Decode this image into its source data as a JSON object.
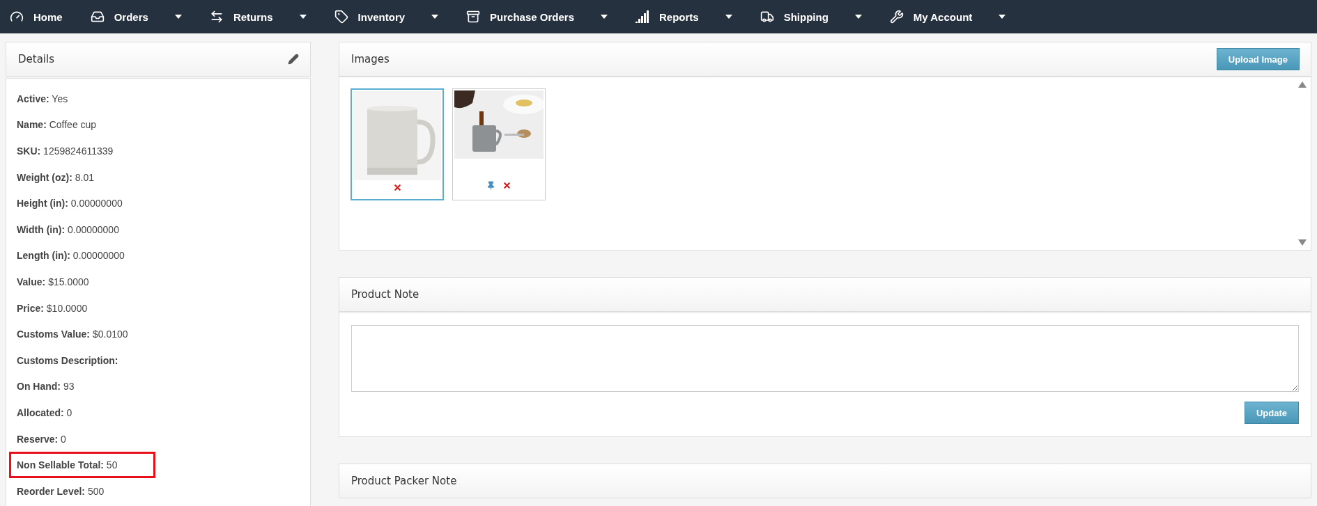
{
  "nav": [
    {
      "label": "Home",
      "dropdown": false
    },
    {
      "label": "Orders",
      "dropdown": true
    },
    {
      "label": "Returns",
      "dropdown": true
    },
    {
      "label": "Inventory",
      "dropdown": true
    },
    {
      "label": "Purchase Orders",
      "dropdown": true
    },
    {
      "label": "Reports",
      "dropdown": true
    },
    {
      "label": "Shipping",
      "dropdown": true
    },
    {
      "label": "My Account",
      "dropdown": true
    }
  ],
  "details": {
    "title": "Details",
    "fields": [
      {
        "label": "Active:",
        "value": "Yes",
        "highlighted": false
      },
      {
        "label": "Name:",
        "value": "Coffee cup",
        "highlighted": false
      },
      {
        "label": "SKU:",
        "value": "1259824611339",
        "highlighted": false
      },
      {
        "label": "Weight (oz):",
        "value": "8.01",
        "highlighted": false
      },
      {
        "label": "Height (in):",
        "value": "0.00000000",
        "highlighted": false
      },
      {
        "label": "Width (in):",
        "value": "0.00000000",
        "highlighted": false
      },
      {
        "label": "Length (in):",
        "value": "0.00000000",
        "highlighted": false
      },
      {
        "label": "Value:",
        "value": "$15.0000",
        "highlighted": false
      },
      {
        "label": "Price:",
        "value": "$10.0000",
        "highlighted": false
      },
      {
        "label": "Customs Value:",
        "value": "$0.0100",
        "highlighted": false
      },
      {
        "label": "Customs Description:",
        "highlighted": false
      },
      {
        "label": "On Hand:",
        "value": "93",
        "highlighted": false
      },
      {
        "label": "Allocated:",
        "value": "0",
        "highlighted": false
      },
      {
        "label": "Reserve:",
        "value": "0",
        "highlighted": false
      },
      {
        "label": "Non Sellable Total:",
        "value": "50",
        "highlighted": true
      },
      {
        "label": "Reorder Level:",
        "value": "500",
        "highlighted": false
      }
    ]
  },
  "images": {
    "title": "Images",
    "upload_button": "Upload Image",
    "items": [
      {
        "kind": "picture",
        "selected": true
      },
      {
        "kind": "picture",
        "selected": false
      }
    ]
  },
  "product_note": {
    "title": "Product Note",
    "button": "Update"
  },
  "packer_note": {
    "title": "Product Packer Note"
  }
}
